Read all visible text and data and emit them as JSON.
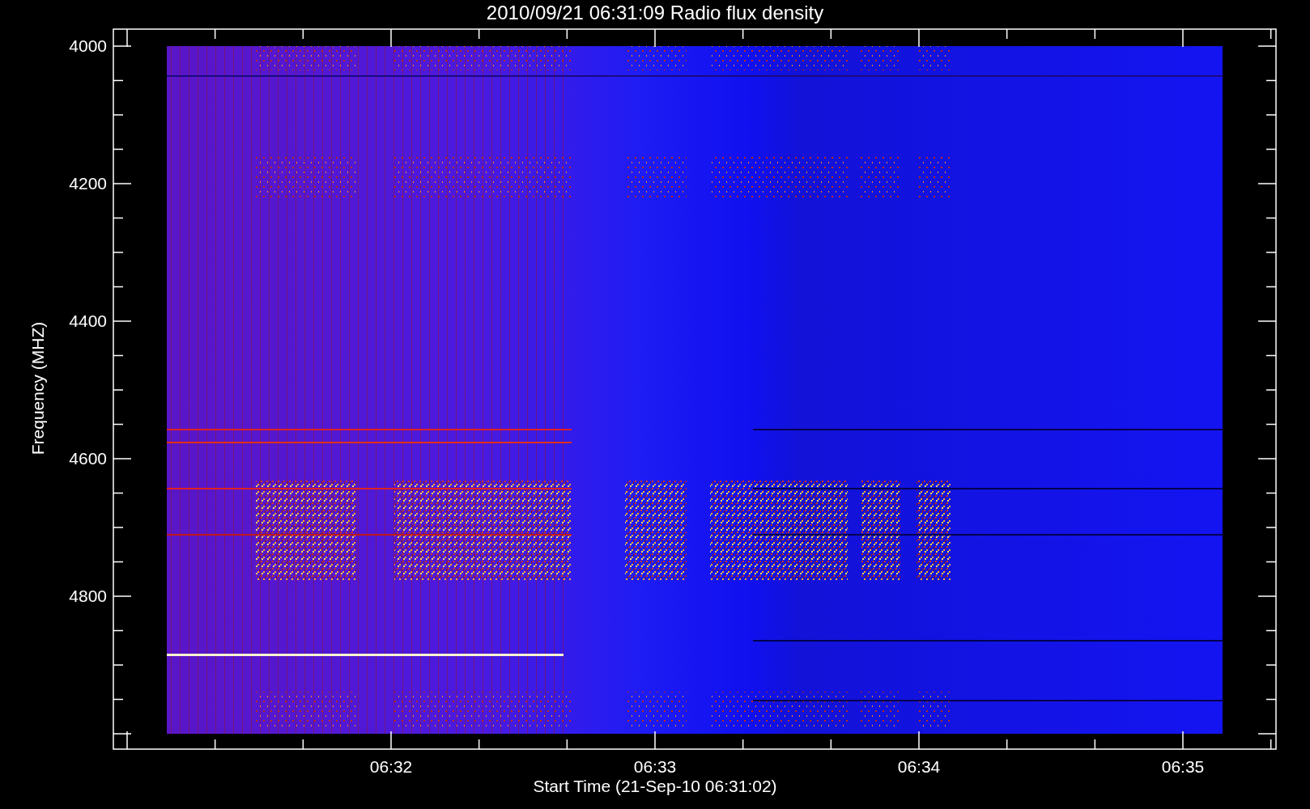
{
  "title": "2010/09/21 06:31:09 Radio flux density",
  "plot": {
    "ylabel": "Frequency (MHZ)",
    "yticks": [
      "4000",
      "4200",
      "4400",
      "4600",
      "4800"
    ],
    "xlabel": "Start Time (21-Sep-10 06:31:02)",
    "xticks": [
      "06:32",
      "06:33",
      "06:34",
      "06:35"
    ]
  }
}
